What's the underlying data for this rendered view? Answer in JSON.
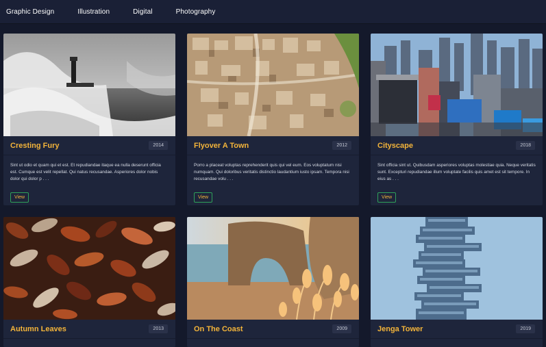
{
  "nav": {
    "items": [
      "Graphic Design",
      "Illustration",
      "Digital",
      "Photography"
    ]
  },
  "cards": [
    {
      "title": "Cresting Fury",
      "year": "2014",
      "description": "Sint ut odio et quam qui et est. Et repudiandae itaque ea nulla deserunt officia est. Cumque est velit repellat. Qui natus recusandae. Asperiores dolor nobis dolor qui dolor p . . .",
      "button": "View"
    },
    {
      "title": "Flyover A Town",
      "year": "2012",
      "description": "Porro a placeat voluptas reprehenderit quis qui vel eum. Eos voluptatum nisi numquam. Qui doloribus veritatis distinctio laudantium iusto ipsam. Tempora nisi recusandae volu . . .",
      "button": "View"
    },
    {
      "title": "Cityscape",
      "year": "2018",
      "description": "Sint officia sint ut. Quibusdam asperiores voluptas molestiae quia. Neque veritatis sunt. Excepturi repudiandae illum voluptate facilis quis amet est sit tempore. In eius as . . .",
      "button": "View"
    },
    {
      "title": "Autumn Leaves",
      "year": "2013",
      "description": "",
      "button": ""
    },
    {
      "title": "On The Coast",
      "year": "2009",
      "description": "",
      "button": ""
    },
    {
      "title": "Jenga Tower",
      "year": "2019",
      "description": "",
      "button": ""
    }
  ]
}
